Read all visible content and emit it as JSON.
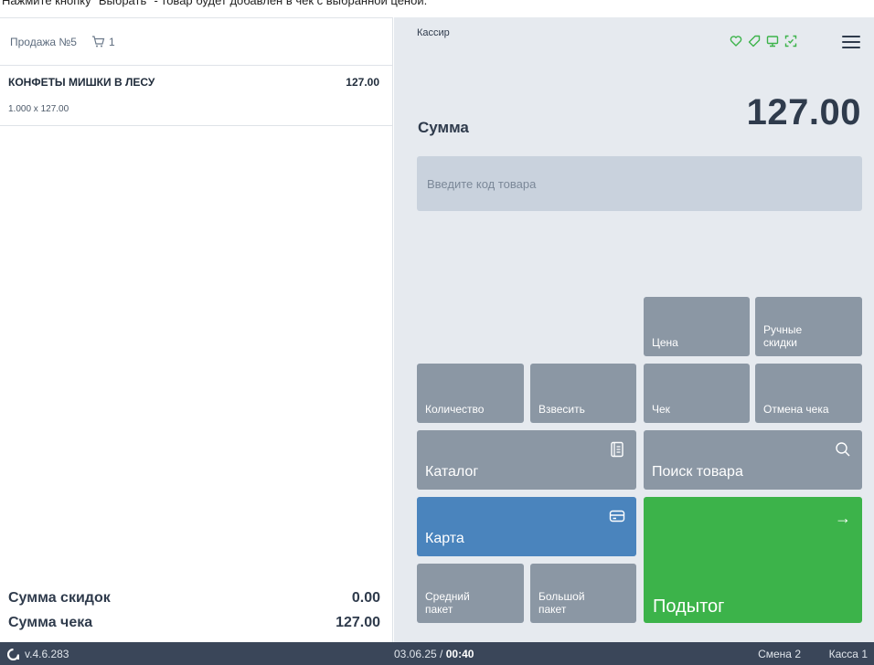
{
  "instruction": "Нажмите кнопку \"Выбрать\" - товар будет добавлен в чек с выбранной ценой.",
  "receipt": {
    "title": "Продажа №5",
    "cart_count": "1",
    "items": [
      {
        "name": "КОНФЕТЫ МИШКИ В ЛЕСУ",
        "price": "127.00",
        "qty": "1.000 x 127.00"
      }
    ],
    "discount_label": "Сумма скидок",
    "discount_value": "0.00",
    "total_label": "Сумма чека",
    "total_value": "127.00"
  },
  "header": {
    "cashier": "Кассир",
    "status_icons": [
      "heart-icon",
      "tag-icon",
      "monitor-icon",
      "scan-icon"
    ],
    "accent_color": "#3cb34a"
  },
  "sum": {
    "label": "Сумма",
    "value": "127.00"
  },
  "search": {
    "placeholder": "Введите код товара"
  },
  "buttons": {
    "price": "Цена",
    "manual_discounts": "Ручные скидки",
    "quantity": "Количество",
    "weigh": "Взвесить",
    "receipt": "Чек",
    "cancel_receipt": "Отмена чека",
    "catalog": "Каталог",
    "product_search": "Поиск товара",
    "card": "Карта",
    "medium_bag": "Средний пакет",
    "large_bag": "Большой пакет",
    "subtotal": "Подытог",
    "subtotal_arrow": "→"
  },
  "status_bar": {
    "version": "v.4.6.283",
    "date": "03.06.25",
    "separator": " / ",
    "time": "00:40",
    "shift": "Смена 2",
    "register": "Касса 1"
  }
}
